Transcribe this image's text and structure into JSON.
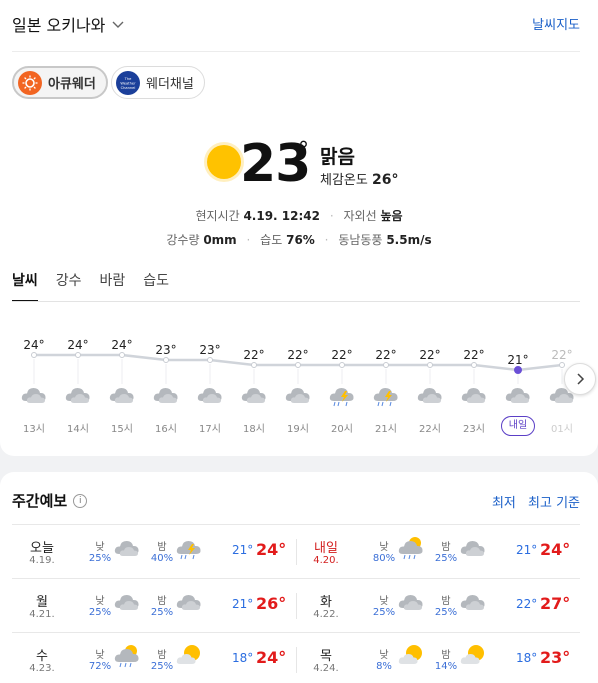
{
  "header": {
    "location": "일본 오키나와",
    "map_link": "날씨지도"
  },
  "providers": [
    {
      "label": "아큐웨더",
      "active": true
    },
    {
      "label": "웨더채널",
      "logo_text": "The Weather Channel",
      "active": false
    }
  ],
  "current": {
    "temp": "23",
    "deg": "°",
    "condition": "맑음",
    "feels_label": "체감온도",
    "feels_value": "26°",
    "local_time_label": "현지시간",
    "local_time_value": "4.19. 12:42",
    "uv_label": "자외선",
    "uv_value": "높음",
    "precip_label": "강수량",
    "precip_value": "0mm",
    "humidity_label": "습도",
    "humidity_value": "76%",
    "wind_label": "동남동풍",
    "wind_value": "5.5m/s"
  },
  "tabs": [
    "날씨",
    "강수",
    "바람",
    "습도"
  ],
  "active_tab": "날씨",
  "hourly": [
    {
      "time": "13시",
      "temp": "24°",
      "t": 24,
      "icon": "cloudy-icon"
    },
    {
      "time": "14시",
      "temp": "24°",
      "t": 24,
      "icon": "cloudy-icon"
    },
    {
      "time": "15시",
      "temp": "24°",
      "t": 24,
      "icon": "cloudy-icon"
    },
    {
      "time": "16시",
      "temp": "23°",
      "t": 23,
      "icon": "cloudy-icon"
    },
    {
      "time": "17시",
      "temp": "23°",
      "t": 23,
      "icon": "cloudy-icon"
    },
    {
      "time": "18시",
      "temp": "22°",
      "t": 22,
      "icon": "cloudy-icon"
    },
    {
      "time": "19시",
      "temp": "22°",
      "t": 22,
      "icon": "cloudy-icon"
    },
    {
      "time": "20시",
      "temp": "22°",
      "t": 22,
      "icon": "thunderstorm-icon"
    },
    {
      "time": "21시",
      "temp": "22°",
      "t": 22,
      "icon": "thunderstorm-icon"
    },
    {
      "time": "22시",
      "temp": "22°",
      "t": 22,
      "icon": "cloudy-icon"
    },
    {
      "time": "23시",
      "temp": "22°",
      "t": 22,
      "icon": "cloudy-icon"
    },
    {
      "time": "내일",
      "temp": "21°",
      "t": 21,
      "icon": "cloudy-icon",
      "tomorrow": true
    },
    {
      "time": "01시",
      "temp": "22°",
      "t": 22,
      "icon": "cloudy-icon"
    }
  ],
  "weekly": {
    "title": "주간예보",
    "sort_low": "최저",
    "sort_high": "최고 기준",
    "day_label": "낮",
    "night_label": "밤",
    "days": [
      {
        "day": "오늘",
        "date": "4.19.",
        "am_pct": "25%",
        "am_icon": "cloudy-icon",
        "pm_pct": "40%",
        "pm_icon": "thunderstorm-icon",
        "min": "21°",
        "max": "24°"
      },
      {
        "day": "내일",
        "date": "4.20.",
        "am_pct": "80%",
        "am_icon": "rain-sun-icon",
        "pm_pct": "25%",
        "pm_icon": "cloudy-icon",
        "min": "21°",
        "max": "24°",
        "tomorrow": true
      },
      {
        "day": "월",
        "date": "4.21.",
        "am_pct": "25%",
        "am_icon": "cloudy-icon",
        "pm_pct": "25%",
        "pm_icon": "cloudy-icon",
        "min": "21°",
        "max": "26°"
      },
      {
        "day": "화",
        "date": "4.22.",
        "am_pct": "25%",
        "am_icon": "cloudy-icon",
        "pm_pct": "25%",
        "pm_icon": "cloudy-icon",
        "min": "22°",
        "max": "27°"
      },
      {
        "day": "수",
        "date": "4.23.",
        "am_pct": "72%",
        "am_icon": "rain-sun-icon",
        "pm_pct": "25%",
        "pm_icon": "partly-cloudy-icon",
        "min": "18°",
        "max": "24°"
      },
      {
        "day": "목",
        "date": "4.24.",
        "am_pct": "8%",
        "am_icon": "partly-cloudy-icon",
        "pm_pct": "14%",
        "pm_icon": "partly-cloudy-icon",
        "min": "18°",
        "max": "23°"
      }
    ]
  },
  "colors": {
    "accent": "#1a5fc8",
    "max_temp": "#e21b1b",
    "min_temp": "#2b6de0",
    "tomorrow": "#5b3fc6",
    "sun": "#ffbf00"
  }
}
